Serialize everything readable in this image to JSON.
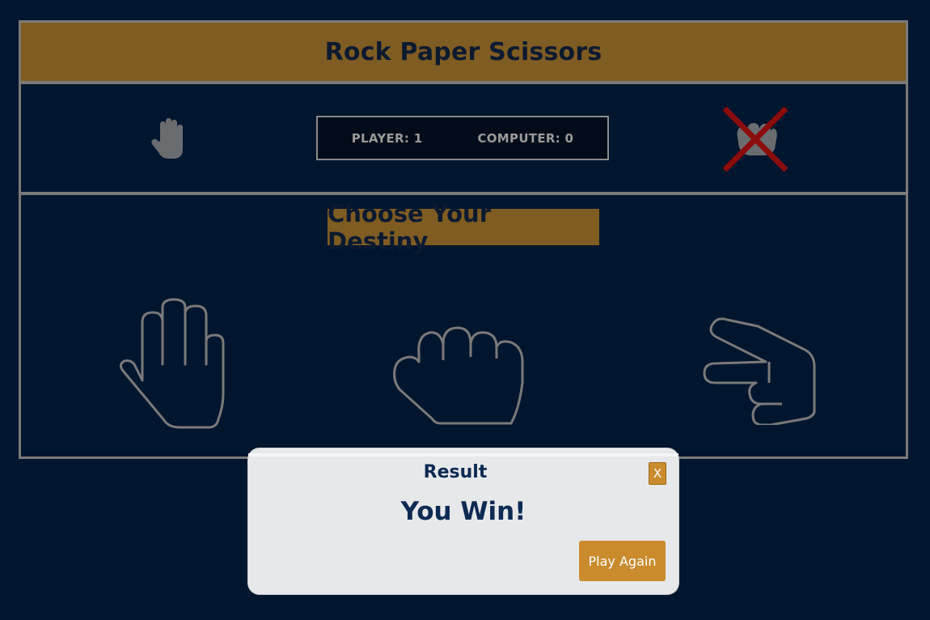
{
  "app": {
    "title": "Rock Paper Scissors"
  },
  "scoreboard": {
    "player": "PLAYER: 1",
    "computer": "COMPUTER: 0"
  },
  "round": {
    "player_choice_icon": "paper-hand-icon",
    "computer_choice_icon": "rock-fist-icon",
    "computer_marked_loser": true
  },
  "choices": {
    "title": "Choose Your Destiny",
    "items": [
      {
        "name": "paper",
        "icon": "paper-hand-icon"
      },
      {
        "name": "rock",
        "icon": "rock-fist-icon"
      },
      {
        "name": "scissors",
        "icon": "scissors-hand-icon"
      }
    ]
  },
  "modal": {
    "title": "Result",
    "close_label": "X",
    "result": "You Win!",
    "play_again_label": "Play Again"
  },
  "colors": {
    "background": "#00162e",
    "accent": "#7f5c22",
    "button": "#c98b2c",
    "border": "#7a7a7a",
    "lose_mark": "#8b0c0c"
  }
}
